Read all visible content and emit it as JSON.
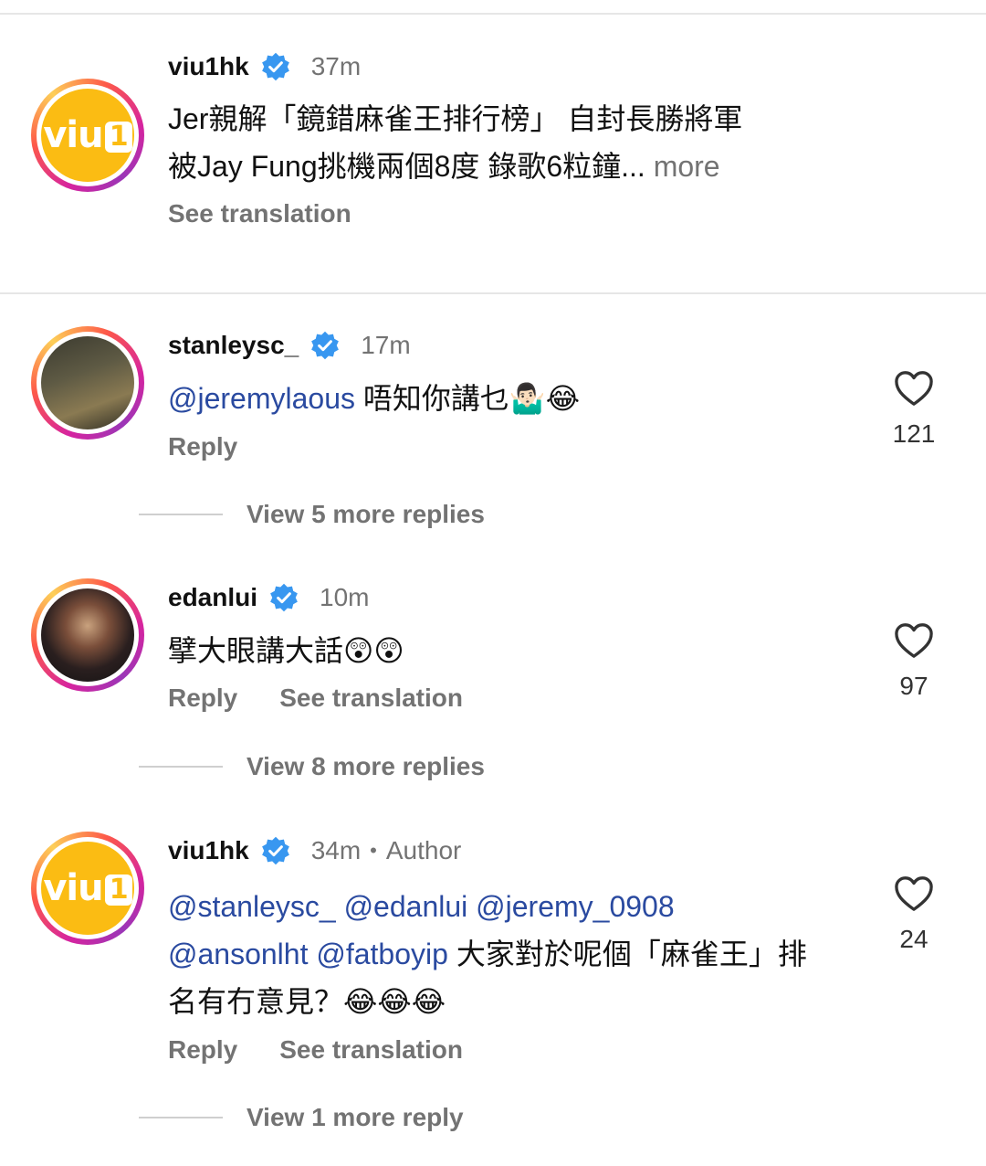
{
  "comments": [
    {
      "username": "viu1hk",
      "time": "37m",
      "text_line1": "Jer親解「鏡錯麻雀王排行榜」 自封長勝將軍",
      "text_line2": "被Jay Fung挑機兩個8度 錄歌6粒鐘...",
      "more_label": " more",
      "see_translation": "See translation"
    },
    {
      "username": "stanleysc_",
      "time": "17m",
      "mention": "@jeremylaous",
      "text": " 唔知你講乜🤷🏻‍♂️😂",
      "reply_label": "Reply",
      "likes": "121",
      "view_replies": "View 5 more replies"
    },
    {
      "username": "edanlui",
      "time": "10m",
      "text": "擘大眼講大話😲😲",
      "reply_label": "Reply",
      "see_translation": "See translation",
      "likes": "97",
      "view_replies": "View 8 more replies"
    },
    {
      "username": "viu1hk",
      "time": "34m",
      "author_label": "Author",
      "mentions_line1": "@stanleysc_ @edanlui @jeremy_0908",
      "mentions_line2": "@ansonlht @fatboyip",
      "text_line2": " 大家對於呢個「麻雀王」排",
      "text_line3": "名有冇意見？😂😂😂",
      "reply_label": "Reply",
      "see_translation": "See translation",
      "likes": "24",
      "view_replies": "View 1 more reply"
    }
  ],
  "brand": {
    "logo_text": "viu",
    "logo_digit": "1"
  },
  "colors": {
    "mention": "#2a4aa0",
    "muted": "#737373",
    "verified": "#3897f0",
    "viu_yellow": "#fbbc13"
  }
}
